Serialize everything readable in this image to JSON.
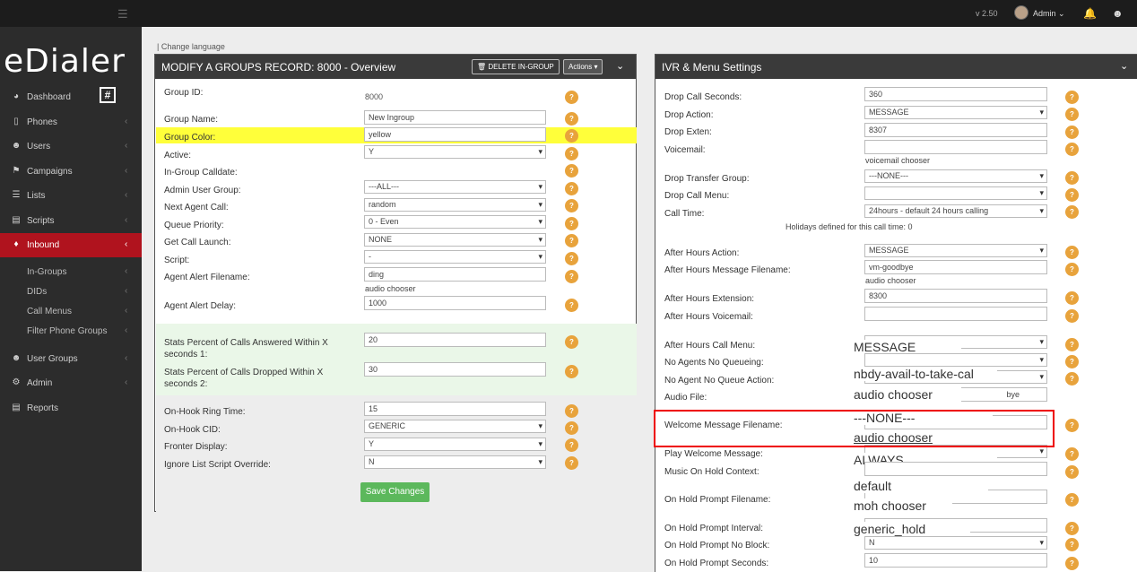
{
  "topbar": {
    "version": "v 2.50",
    "user": "Admin",
    "icons": [
      "menu-icon",
      "bell-icon",
      "users-icon"
    ]
  },
  "brand": {
    "name": "eDialer",
    "badge": "#"
  },
  "nav": [
    {
      "label": "Dashboard",
      "icon": "dashboard-icon"
    },
    {
      "label": "Phones",
      "icon": "phone-icon"
    },
    {
      "label": "Users",
      "icon": "users-icon"
    },
    {
      "label": "Campaigns",
      "icon": "flag-icon"
    },
    {
      "label": "Lists",
      "icon": "list-icon"
    },
    {
      "label": "Scripts",
      "icon": "script-icon"
    },
    {
      "label": "Inbound",
      "icon": "diamond-icon"
    },
    {
      "label": "User Groups",
      "icon": "user-group-icon"
    },
    {
      "label": "Admin",
      "icon": "admin-icon"
    },
    {
      "label": "Reports",
      "icon": "report-icon"
    }
  ],
  "inbound_sub": [
    "In-Groups",
    "DIDs",
    "Call Menus",
    "Filter Phone Groups"
  ],
  "change_language": "Change language",
  "left_panel": {
    "title": "MODIFY A GROUPS RECORD: 8000 - Overview",
    "delete_btn": "DELETE IN-GROUP",
    "actions_btn": "Actions",
    "group_id_label": "Group ID:",
    "group_id_value": "8000",
    "group_name_label": "Group Name:",
    "group_name_value": "New Ingroup",
    "group_color_label": "Group Color:",
    "group_color_value": "yellow",
    "active_label": "Active:",
    "active_value": "Y",
    "calldate_label": "In-Group Calldate:",
    "admin_group_label": "Admin User Group:",
    "admin_group_value": "---ALL---",
    "next_agent_label": "Next Agent Call:",
    "next_agent_value": "random",
    "queue_priority_label": "Queue Priority:",
    "queue_priority_value": "0 - Even",
    "get_call_launch_label": "Get Call Launch:",
    "get_call_launch_value": "NONE",
    "script_label": "Script:",
    "script_value": "-",
    "alert_file_label": "Agent Alert Filename:",
    "alert_file_value": "ding",
    "audio_chooser": "audio chooser",
    "alert_delay_label": "Agent Alert Delay:",
    "alert_delay_value": "1000",
    "stats_answered_label": "Stats Percent of Calls Answered Within X seconds 1:",
    "stats_answered_value": "20",
    "stats_dropped_label": "Stats Percent of Calls Dropped Within X seconds 2:",
    "stats_dropped_value": "30",
    "ring_time_label": "On-Hook Ring Time:",
    "ring_time_value": "15",
    "onhook_cid_label": "On-Hook CID:",
    "onhook_cid_value": "GENERIC",
    "fronter_label": "Fronter Display:",
    "fronter_value": "Y",
    "ignore_label": "Ignore List Script Override:",
    "ignore_value": "N",
    "save_btn": "Save Changes"
  },
  "right_panel": {
    "title": "IVR & Menu Settings",
    "drop_seconds_label": "Drop Call Seconds:",
    "drop_seconds_value": "360",
    "drop_action_label": "Drop Action:",
    "drop_action_value": "MESSAGE",
    "drop_exten_label": "Drop Exten:",
    "drop_exten_value": "8307",
    "voicemail_label": "Voicemail:",
    "voicemail_chooser": "voicemail chooser",
    "drop_transfer_label": "Drop Transfer Group:",
    "drop_transfer_value": "---NONE---",
    "drop_menu_label": "Drop Call Menu:",
    "call_time_label": "Call Time:",
    "call_time_value": "24hours - default 24 hours calling",
    "holidays_note": "Holidays defined for this call time: 0",
    "ah_action_label": "After Hours Action:",
    "ah_action_value": "MESSAGE",
    "ah_msg_label": "After Hours Message Filename:",
    "ah_msg_value": "vm-goodbye",
    "audio_chooser": "audio chooser",
    "ah_ext_label": "After Hours Extension:",
    "ah_ext_value": "8300",
    "ah_vm_label": "After Hours Voicemail:",
    "ah_menu_label": "After Hours Call Menu:",
    "ah_menu_value": "MESSAGE",
    "no_agents_label": "No Agents No Queueing:",
    "no_agent_action_label": "No Agent No Queue Action:",
    "no_agent_action_value": "nbdy-avail-to-take-cal",
    "audio_file_label": "Audio File:",
    "audio_file_value": "bye",
    "welcome_label": "Welcome Message Filename:",
    "welcome_value": "---NONE---",
    "play_welcome_label": "Play Welcome Message:",
    "play_welcome_value": "ALWAYS",
    "moh_label": "Music On Hold Context:",
    "moh_value": "default",
    "moh_chooser": "moh chooser",
    "hold_prompt_label": "On Hold Prompt Filename:",
    "hold_prompt_value": "generic_hold",
    "hold_interval_label": "On Hold Prompt Interval:",
    "hold_noblock_label": "On Hold Prompt No Block:",
    "hold_noblock_value": "N",
    "hold_seconds_label": "On Hold Prompt Seconds:",
    "hold_seconds_value": "10"
  },
  "colors": {
    "sidebar": "#2c2c2c",
    "active": "#b0131e",
    "highlight": "#ffff3a",
    "help": "#e8a33c",
    "save": "#5cb85c",
    "annotation": "#e00000"
  }
}
